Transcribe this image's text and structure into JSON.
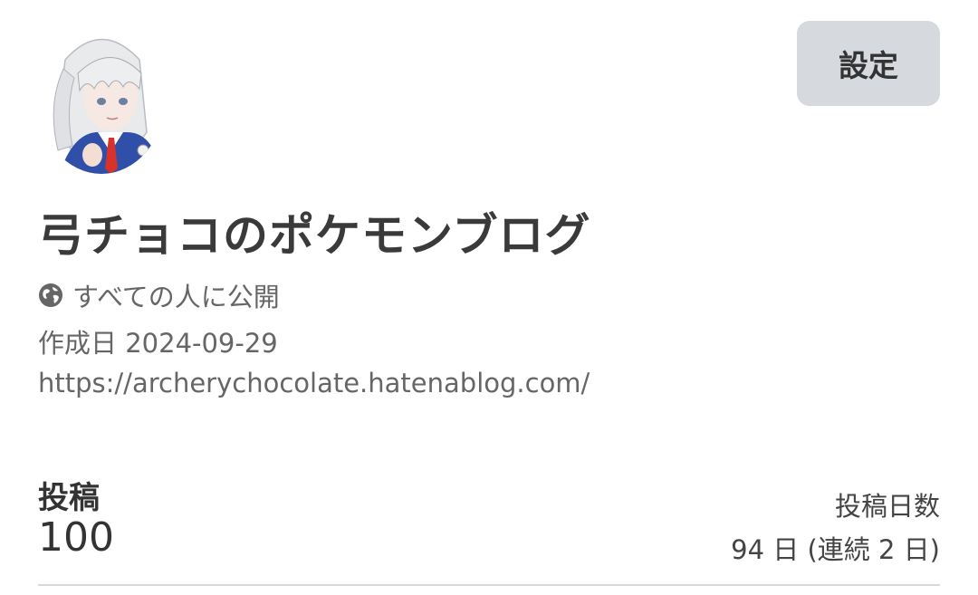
{
  "profile": {
    "avatar_icon": "avatar-illustration",
    "settings_label": "設定",
    "blog_title": "弓チョコのポケモンブログ",
    "visibility_icon": "globe-icon",
    "visibility_text": "すべての人に公開",
    "created_text": "作成日 2024-09-29",
    "url": "https://archerychocolate.hatenablog.com/"
  },
  "stats": {
    "posts_label": "投稿",
    "posts_count": "100",
    "days_label": "投稿日数",
    "days_value": "94 日 (連続 2 日)"
  },
  "colors": {
    "button_bg": "#d6d9dd",
    "title": "#3a3a3a",
    "meta": "#666666",
    "divider": "#d9d9d9"
  }
}
